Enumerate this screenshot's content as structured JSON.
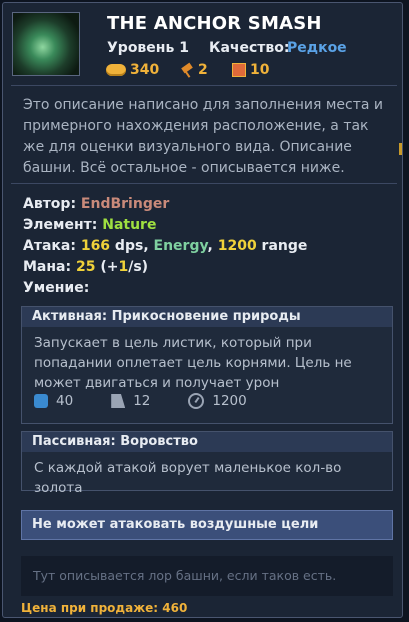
{
  "tower": {
    "title": "THE ANCHOR SMASH",
    "level": "Уровень 1",
    "quality_label": "Качество:",
    "quality_value": "Редкое",
    "resources": [
      {
        "icon": "coins-icon",
        "value": "340"
      },
      {
        "icon": "hammer-icon",
        "value": "2"
      },
      {
        "icon": "book-icon",
        "value": "10"
      }
    ],
    "description": "Это описание написано для заполнения места и примерного нахождения расположение, а так же для оценки визуального вида. Описание башни. Всё остальное - описывается ниже."
  },
  "stats": {
    "author_label": "Автор:",
    "author_value": "EndBringer",
    "element_label": "Элемент:",
    "element_value": "Nature",
    "attack_label": "Атака:",
    "attack_dps": "166",
    "attack_dps_unit": " dps, ",
    "attack_type": "Energy",
    "attack_comma": ", ",
    "attack_range": "1200",
    "attack_range_unit": " range",
    "mana_label": "Мана:",
    "mana_value": "25",
    "mana_regen_open": " (+",
    "mana_regen": "1",
    "mana_regen_close": "/s)",
    "ability_label": "Умение:"
  },
  "active_skill": {
    "header": "Активная: Прикосновение природы",
    "text": "Запускает в цель листик, который при попадании оплетает цель корнями. Цель не может двигаться и получает урон",
    "params": [
      {
        "icon": "mana-cost-icon",
        "value": "40"
      },
      {
        "icon": "cooldown-icon",
        "value": "12"
      },
      {
        "icon": "range-icon",
        "value": "1200"
      }
    ]
  },
  "passive_skill": {
    "header": "Пассивная: Воровство",
    "text": "С каждой атакой ворует маленькое кол-во золота"
  },
  "warning": "Не может атаковать воздушные цели",
  "lore": "Тут описывается лор башни, если таков есть.",
  "price": "Цена при продаже: 460",
  "colors": {
    "accent_blue": "#5aa2e6",
    "gold": "#f0b23a",
    "nature": "#9fe040"
  }
}
